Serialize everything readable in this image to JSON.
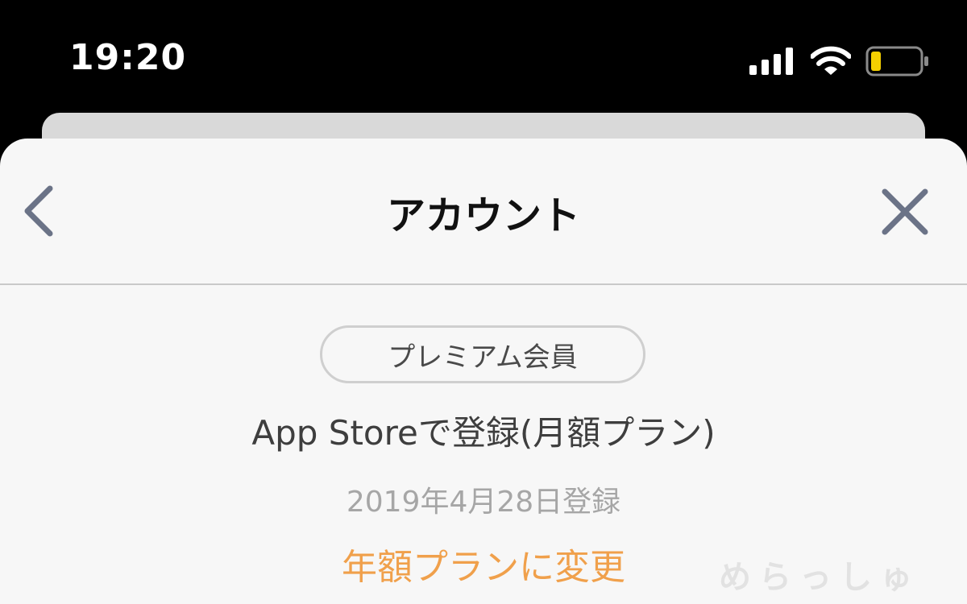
{
  "status_bar": {
    "time": "19:20",
    "icons": [
      "signal-icon",
      "wifi-icon",
      "battery-icon"
    ],
    "battery_color": "#f5d000"
  },
  "nav": {
    "title": "アカウント",
    "back_icon": "chevron-left-icon",
    "close_icon": "close-icon"
  },
  "account": {
    "badge": "プレミアム会員",
    "plan": "App Storeで登録(月額プラン)",
    "registered": "2019年4月28日登録",
    "change_plan": "年額プランに変更"
  },
  "watermark": "めらっしゅ",
  "colors": {
    "accent": "#f0a04b",
    "nav_icon": "#6b7387",
    "sheet_bg": "#f7f7f7"
  }
}
